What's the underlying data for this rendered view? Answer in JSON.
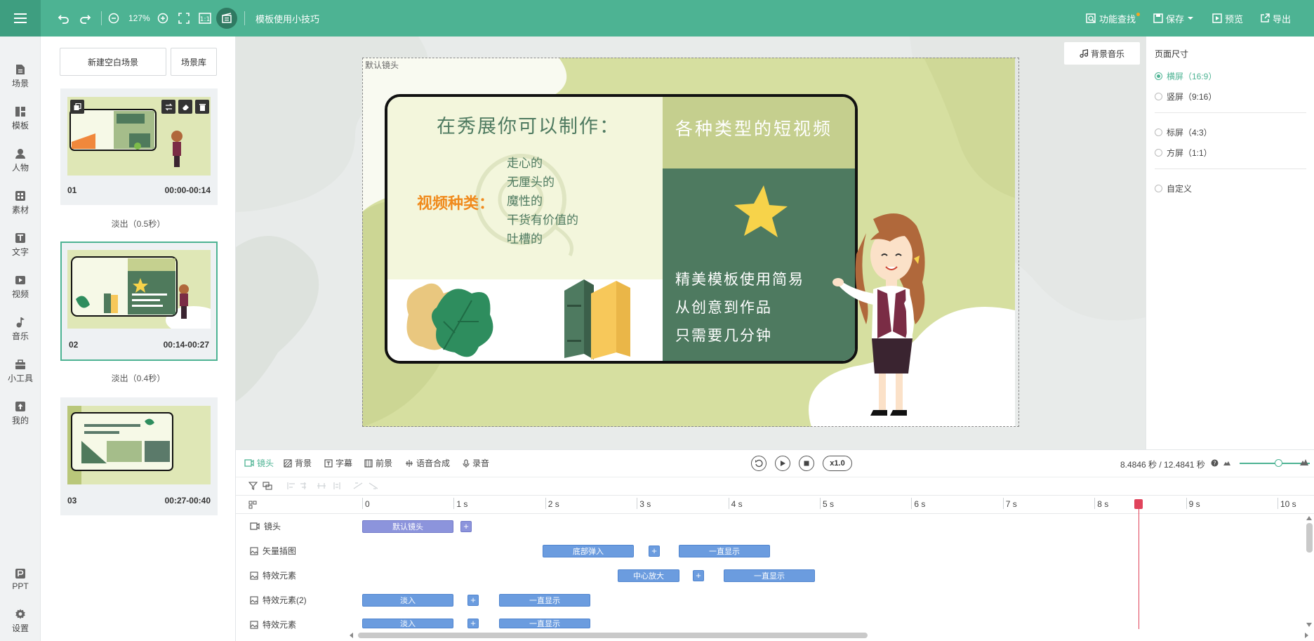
{
  "topbar": {
    "zoom": "127%",
    "project_title": "模板使用小技巧",
    "func_search": "功能查找",
    "save": "保存",
    "preview": "预览",
    "export": "导出"
  },
  "rail": {
    "items": [
      "场景",
      "模板",
      "人物",
      "素材",
      "文字",
      "视频",
      "音乐",
      "小工具",
      "我的"
    ],
    "ppt": "PPT",
    "settings": "设置"
  },
  "scenes": {
    "new_blank": "新建空白场景",
    "library": "场景库",
    "list": [
      {
        "num": "01",
        "time": "00:00-00:14"
      },
      {
        "num": "02",
        "time": "00:14-00:27"
      },
      {
        "num": "03",
        "time": "00:27-00:40"
      }
    ],
    "transitions": [
      "淡出（0.5秒）",
      "淡出（0.4秒）"
    ]
  },
  "canvas": {
    "lens_label": "默认镜头",
    "bg_music": "背景音乐",
    "left_heading": "在秀展你可以制作：",
    "right_heading": "各种类型的短视频",
    "video_types_label": "视频种类：",
    "video_types": [
      "走心的",
      "无厘头的",
      "魔性的",
      "干货有价值的",
      "吐槽的"
    ],
    "slogans": [
      "精美模板使用简易",
      "从创意到作品",
      "只需要几分钟"
    ]
  },
  "right_panel": {
    "title": "页面尺寸",
    "options": [
      {
        "label": "横屏（16:9）",
        "selected": true
      },
      {
        "label": "竖屏（9:16）",
        "selected": false
      },
      {
        "label": "标屏（4:3）",
        "selected": false
      },
      {
        "label": "方屏（1:1）",
        "selected": false
      },
      {
        "label": "自定义",
        "selected": false
      }
    ]
  },
  "timeline": {
    "tabs": [
      "镜头",
      "背景",
      "字幕",
      "前景",
      "语音合成",
      "录音"
    ],
    "speed": "x1.0",
    "time_display": "8.4846 秒 / 12.4841 秒",
    "ticks": [
      "0",
      "1 s",
      "2 s",
      "3 s",
      "4 s",
      "5 s",
      "6 s",
      "7 s",
      "8 s",
      "9 s",
      "10 s"
    ],
    "playhead_seconds": 8.48,
    "tracks": [
      {
        "label": "镜头",
        "clips": [
          "默认镜头"
        ]
      },
      {
        "label": "矢量插图",
        "clips": [
          "底部弹入",
          "一直显示"
        ]
      },
      {
        "label": "特效元素",
        "clips": [
          "中心放大",
          "一直显示"
        ]
      },
      {
        "label": "特效元素(2)",
        "clips": [
          "淡入",
          "一直显示"
        ]
      },
      {
        "label": "特效元素",
        "clips": [
          "淡入",
          "一直显示"
        ]
      }
    ]
  },
  "colors": {
    "brand": "#4db393",
    "clip_blue": "#6b9cdf",
    "playhead": "#e0435b"
  }
}
